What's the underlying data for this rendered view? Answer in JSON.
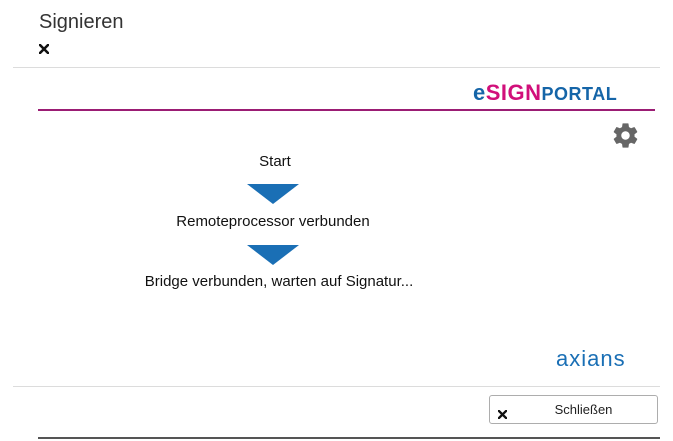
{
  "dialog": {
    "title": "Signieren"
  },
  "brand": {
    "e": "e",
    "sign": "SIGN",
    "portal": "PORTAL",
    "colors": {
      "blue": "#1565a8",
      "magenta": "#d10f7a",
      "line": "#9b1d74"
    }
  },
  "steps": [
    {
      "label": "Start"
    },
    {
      "label": "Remoteprocessor verbunden"
    },
    {
      "label": "Bridge verbunden, warten auf Signatur..."
    }
  ],
  "footer_logo": "axians",
  "buttons": {
    "close_label": "Schließen"
  },
  "icons": {
    "close": "close-icon",
    "settings": "gear-icon",
    "step_arrow": "triangle-down-icon"
  }
}
